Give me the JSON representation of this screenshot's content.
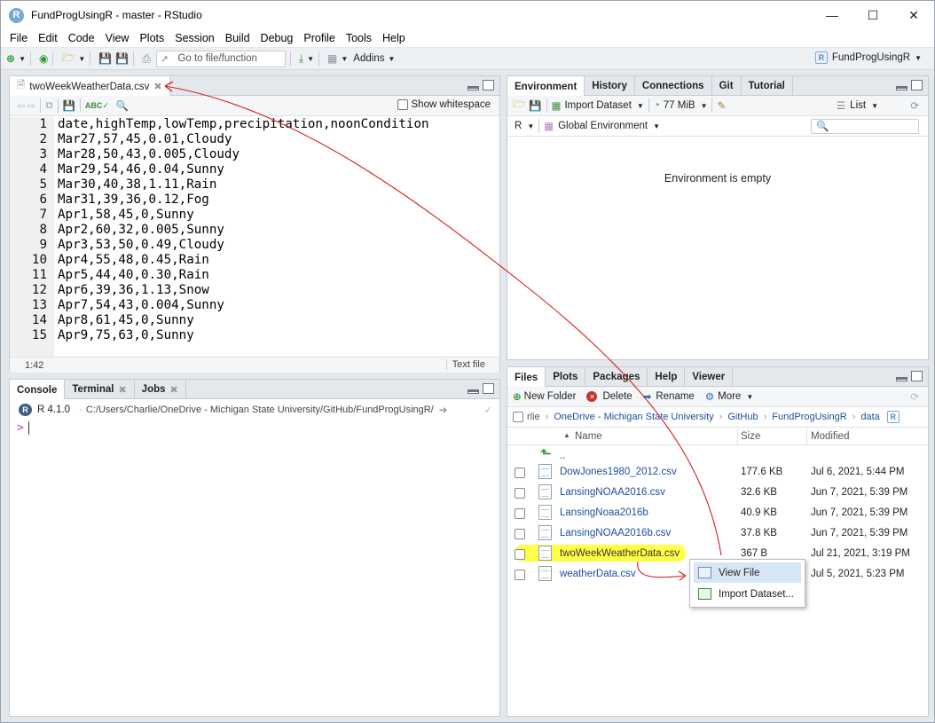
{
  "window": {
    "title": "FundProgUsingR - master - RStudio"
  },
  "menus": [
    "File",
    "Edit",
    "Code",
    "View",
    "Plots",
    "Session",
    "Build",
    "Debug",
    "Profile",
    "Tools",
    "Help"
  ],
  "toolbar": {
    "goto_placeholder": "Go to file/function",
    "addins_label": "Addins",
    "project_label": "FundProgUsingR"
  },
  "editor": {
    "tab_label": "twoWeekWeatherData.csv",
    "show_whitespace_label": "Show whitespace",
    "lines": [
      "date,highTemp,lowTemp,precipitation,noonCondition",
      "Mar27,57,45,0.01,Cloudy",
      "Mar28,50,43,0.005,Cloudy",
      "Mar29,54,46,0.04,Sunny",
      "Mar30,40,38,1.11,Rain",
      "Mar31,39,36,0.12,Fog",
      "Apr1,58,45,0,Sunny",
      "Apr2,60,32,0.005,Sunny",
      "Apr3,53,50,0.49,Cloudy",
      "Apr4,55,48,0.45,Rain",
      "Apr5,44,40,0.30,Rain",
      "Apr6,39,36,1.13,Snow",
      "Apr7,54,43,0.004,Sunny",
      "Apr8,61,45,0,Sunny",
      "Apr9,75,63,0,Sunny"
    ],
    "line_numbers": [
      "1",
      "2",
      "3",
      "4",
      "5",
      "6",
      "7",
      "8",
      "9",
      "10",
      "11",
      "12",
      "13",
      "14",
      "15"
    ],
    "cursor_pos": "1:42",
    "file_type": "Text file"
  },
  "console": {
    "tabs": [
      "Console",
      "Terminal",
      "Jobs"
    ],
    "r_version": "R 4.1.0",
    "path": "C:/Users/Charlie/OneDrive - Michigan State University/GitHub/FundProgUsingR/",
    "prompt": ">"
  },
  "environment": {
    "tabs": [
      "Environment",
      "History",
      "Connections",
      "Git",
      "Tutorial"
    ],
    "import_label": "Import Dataset",
    "memory_label": "77 MiB",
    "list_label": "List",
    "lang_label": "R",
    "scope_label": "Global Environment",
    "empty_message": "Environment is empty"
  },
  "files": {
    "tabs": [
      "Files",
      "Plots",
      "Packages",
      "Help",
      "Viewer"
    ],
    "actions": {
      "new_folder": "New Folder",
      "delete": "Delete",
      "rename": "Rename",
      "more": "More"
    },
    "breadcrumb": [
      "rlie",
      "OneDrive - Michigan State University",
      "GitHub",
      "FundProgUsingR",
      "data"
    ],
    "columns": {
      "name": "Name",
      "size": "Size",
      "modified": "Modified"
    },
    "parent": "..",
    "rows": [
      {
        "name": "DowJones1980_2012.csv",
        "size": "177.6 KB",
        "modified": "Jul 6, 2021, 5:44 PM"
      },
      {
        "name": "LansingNOAA2016.csv",
        "size": "32.6 KB",
        "modified": "Jun 7, 2021, 5:39 PM"
      },
      {
        "name": "LansingNoaa2016b",
        "size": "40.9 KB",
        "modified": "Jun 7, 2021, 5:39 PM"
      },
      {
        "name": "LansingNOAA2016b.csv",
        "size": "37.8 KB",
        "modified": "Jun 7, 2021, 5:39 PM"
      },
      {
        "name": "twoWeekWeatherData.csv",
        "size": "367 B",
        "modified": "Jul 21, 2021, 3:19 PM"
      },
      {
        "name": "weatherData.csv",
        "size": "",
        "modified": "Jul 5, 2021, 5:23 PM"
      }
    ]
  },
  "context_menu": {
    "view_file": "View File",
    "import_dataset": "Import Dataset..."
  },
  "colors": {
    "highlight": "#ffff33",
    "annotation": "#d42020",
    "link": "#1b4fa0"
  }
}
